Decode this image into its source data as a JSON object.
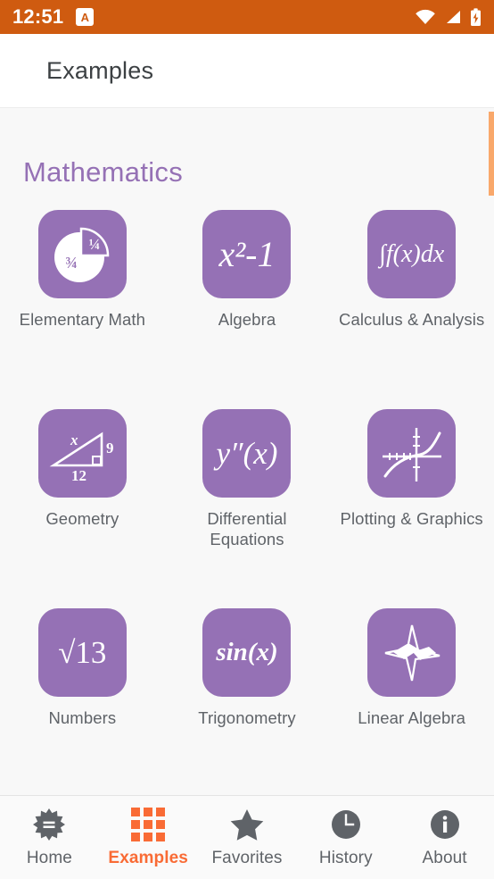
{
  "statusbar": {
    "time": "12:51",
    "app_badge": "A",
    "icons": [
      "wifi-icon",
      "cellular-signal-icon",
      "battery-charging-icon"
    ]
  },
  "appbar": {
    "title": "Examples"
  },
  "content": {
    "section_title": "Mathematics",
    "accent_purple": "#9571b5",
    "accent_orange": "#f96b35",
    "statusbar_color": "#cf5b10",
    "scrollbar_color": "#f9a86b",
    "tiles": [
      {
        "label": "Elementary Math",
        "icon": "pie-fraction-icon",
        "glyph": "",
        "parts": [
          "1/4",
          "3/4"
        ]
      },
      {
        "label": "Algebra",
        "icon": "x-squared-minus-one-icon",
        "glyph": "x²-1"
      },
      {
        "label": "Calculus & Analysis",
        "icon": "integral-icon",
        "glyph": "∫f(x)dx"
      },
      {
        "label": "Geometry",
        "icon": "right-triangle-icon",
        "glyph": "",
        "parts": [
          "x",
          "9",
          "12"
        ]
      },
      {
        "label": "Differential Equations",
        "icon": "second-derivative-icon",
        "glyph": "y″(x)"
      },
      {
        "label": "Plotting & Graphics",
        "icon": "axis-curve-plot-icon",
        "glyph": ""
      },
      {
        "label": "Numbers",
        "icon": "square-root-icon",
        "glyph": "√13"
      },
      {
        "label": "Trigonometry",
        "icon": "sine-function-icon",
        "glyph": "sin(x)"
      },
      {
        "label": "Linear Algebra",
        "icon": "vector-plane-icon",
        "glyph": ""
      }
    ]
  },
  "bottomnav": {
    "active": "Examples",
    "items": [
      {
        "label": "Home",
        "icon": "wolfram-starburst-icon"
      },
      {
        "label": "Examples",
        "icon": "grid-icon"
      },
      {
        "label": "Favorites",
        "icon": "star-icon"
      },
      {
        "label": "History",
        "icon": "clock-icon"
      },
      {
        "label": "About",
        "icon": "info-circle-icon"
      }
    ]
  }
}
